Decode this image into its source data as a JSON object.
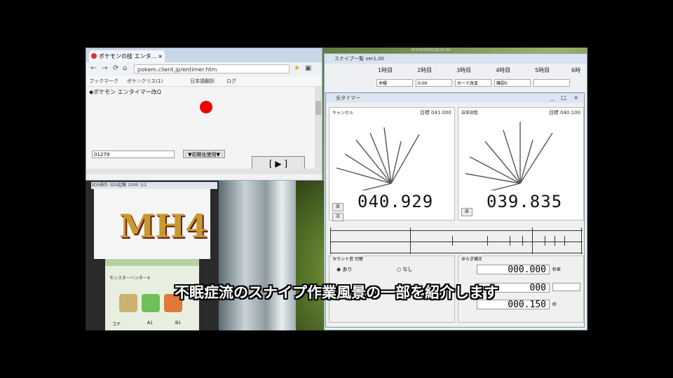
{
  "browser": {
    "tab_title": "ポケモンの技 エンタ…",
    "url": "pokem.client.jp/entimer.htm",
    "bookmarks": [
      "ブックマーク",
      "ポケ☆クリス(1)",
      "日本語翻訳",
      "ログ"
    ],
    "page_heading": "◆ポケモン エンタイマー改Q",
    "input_value": "01279",
    "select_value": "▼初期化使用▼",
    "play_button": "[ ▶ ]"
  },
  "ds": {
    "titlebar": "3DS操作  3DS起動  1000  1/2",
    "logo_text": "MH4",
    "bottom_label": "モンスターハンター4",
    "bottom_sub": [
      "コナ",
      "A1",
      "B1"
    ]
  },
  "tool": {
    "title": "スナイプ一覧 ver1.00",
    "days": [
      "1時目",
      "2時目",
      "3時目",
      "4時目",
      "5時目",
      "6時"
    ],
    "cells": [
      "木曜",
      "0:00",
      "カード改変",
      "確認0",
      "",
      ""
    ]
  },
  "timer": {
    "title": "全タイマー",
    "left_panel": {
      "label": "キャンセル",
      "target_label": "目標",
      "target_value": "041.000",
      "display": "040.929",
      "btn1": "戻",
      "btn2": "次"
    },
    "right_panel": {
      "label": "誤差調整",
      "target_label": "目標",
      "target_value": "040.100",
      "display": "039.835",
      "btn1": "戻"
    },
    "count_group": {
      "label": "カウント音 切替",
      "option_a": "あり",
      "option_b": "なし"
    },
    "adjust_group": {
      "label": "ゆらぎ補正",
      "value1": "000.000",
      "value2": "000",
      "value3": "000.150",
      "unit1": "秒差",
      "unit2": "秒"
    }
  },
  "subtitle": "不眠症流のスナイプ作業風景の一部を紹介します",
  "clock": "2015年09月12日 01:34"
}
